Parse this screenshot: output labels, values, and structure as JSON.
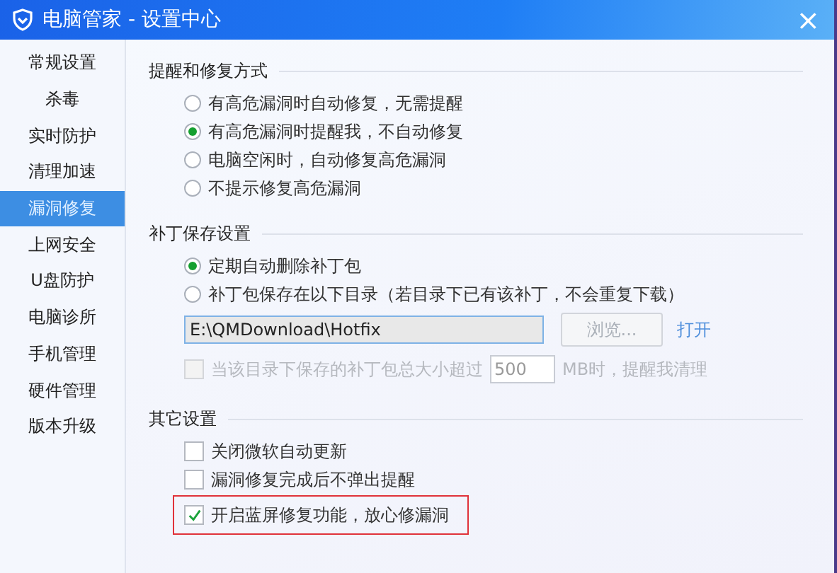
{
  "window": {
    "title": "电脑管家 - 设置中心",
    "close": "×"
  },
  "sidebar": {
    "items": [
      {
        "label": "常规设置",
        "selected": false
      },
      {
        "label": "杀毒",
        "selected": false
      },
      {
        "label": "实时防护",
        "selected": false
      },
      {
        "label": "清理加速",
        "selected": false
      },
      {
        "label": "漏洞修复",
        "selected": true
      },
      {
        "label": "上网安全",
        "selected": false
      },
      {
        "label": "U盘防护",
        "selected": false
      },
      {
        "label": "电脑诊所",
        "selected": false
      },
      {
        "label": "手机管理",
        "selected": false
      },
      {
        "label": "硬件管理",
        "selected": false
      },
      {
        "label": "版本升级",
        "selected": false
      }
    ]
  },
  "sections": [
    {
      "title": "提醒和修复方式",
      "items": [
        {
          "kind": "radio",
          "label": "有高危漏洞时自动修复，无需提醒",
          "selected": false
        },
        {
          "kind": "radio",
          "label": "有高危漏洞时提醒我，不自动修复",
          "selected": true
        },
        {
          "kind": "radio",
          "label": "电脑空闲时，自动修复高危漏洞",
          "selected": false
        },
        {
          "kind": "radio",
          "label": "不提示修复高危漏洞",
          "selected": false
        }
      ]
    },
    {
      "title": "补丁保存设置",
      "items": [
        {
          "kind": "radio",
          "label": "定期自动删除补丁包",
          "selected": true
        },
        {
          "kind": "radio",
          "label": "补丁包保存在以下目录（若目录下已有该补丁，不会重复下载）",
          "selected": false
        },
        {
          "kind": "path",
          "value": "E:\\QMDownload\\Hotfix",
          "button": "浏览...",
          "button_disabled": true,
          "link": "打开"
        },
        {
          "kind": "size-limit",
          "label": "当该目录下保存的补丁包总大小超过",
          "value": "500",
          "suffix": "MB时，提醒我清理",
          "checked": false,
          "disabled": true
        }
      ]
    },
    {
      "title": "其它设置",
      "items": [
        {
          "kind": "checkbox",
          "label": "关闭微软自动更新",
          "checked": false,
          "highlighted": false
        },
        {
          "kind": "checkbox",
          "label": "漏洞修复完成后不弹出提醒",
          "checked": false,
          "highlighted": false
        },
        {
          "kind": "checkbox",
          "label": "开启蓝屏修复功能，放心修漏洞",
          "checked": true,
          "highlighted": true
        }
      ]
    }
  ]
}
